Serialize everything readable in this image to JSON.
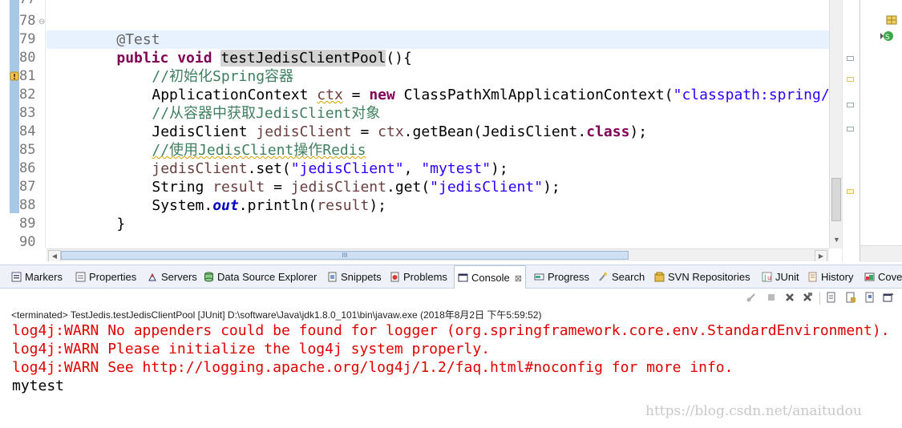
{
  "editor": {
    "line_numbers": [
      "77",
      "78",
      "79",
      "80",
      "81",
      "82",
      "83",
      "84",
      "85",
      "86",
      "87",
      "88",
      "89",
      "90"
    ],
    "annotation": "@Test",
    "method_modifiers": "public void",
    "method_name": "testJedisClientPool",
    "method_tail": "(){",
    "comment_1": "//初始化Spring容器",
    "l81_type": "ApplicationContext",
    "l81_var": "ctx",
    "l81_eq": " = ",
    "l81_new": "new",
    "l81_call": " ClassPathXmlApplicationContext(",
    "l81_str": "\"classpath:spring/app",
    "comment_2": "//从容器中获取JedisClient对象",
    "l83_type": "JedisClient ",
    "l83_var": "jedisClient",
    "l83_mid": " = ",
    "l83_ctx": "ctx",
    "l83_call": ".getBean(JedisClient.",
    "l83_class": "class",
    "l83_end": ");",
    "comment_3": "//使用JedisClient操作Redis",
    "l85_var": "jedisClient",
    "l85_call": ".set(",
    "l85_s1": "\"jedisClient\"",
    "l85_comma": ", ",
    "l85_s2": "\"mytest\"",
    "l85_end": ");",
    "l86_type": "String ",
    "l86_var": "result",
    "l86_eq": " = ",
    "l86_obj": "jedisClient",
    "l86_call": ".get(",
    "l86_s": "\"jedisClient\"",
    "l86_end": ");",
    "l87_a": "System.",
    "l87_out": "out",
    "l87_b": ".println(",
    "l87_arg": "result",
    "l87_end": ");",
    "closing_brace": "}"
  },
  "views_tabs": [
    {
      "label": "Markers",
      "icon": "markers-icon"
    },
    {
      "label": "Properties",
      "icon": "properties-icon"
    },
    {
      "label": "Servers",
      "icon": "servers-icon"
    },
    {
      "label": "Data Source Explorer",
      "icon": "data-source-icon"
    },
    {
      "label": "Snippets",
      "icon": "snippets-icon"
    },
    {
      "label": "Problems",
      "icon": "problems-icon"
    },
    {
      "label": "Console",
      "icon": "console-icon",
      "close": "⊠",
      "active": true
    },
    {
      "label": "Progress",
      "icon": "progress-icon"
    },
    {
      "label": "Search",
      "icon": "search-icon"
    },
    {
      "label": "SVN Repositories",
      "icon": "svn-icon"
    },
    {
      "label": "JUnit",
      "icon": "junit-icon"
    },
    {
      "label": "History",
      "icon": "history-icon"
    },
    {
      "label": "Cove",
      "icon": "coverage-icon"
    }
  ],
  "console": {
    "status": "<terminated> TestJedis.testJedisClientPool [JUnit] D:\\software\\Java\\jdk1.8.0_101\\bin\\javaw.exe (2018年8月2日 下午5:59:52)",
    "lines": [
      {
        "text": "log4j:WARN No appenders could be found for logger (org.springframework.core.env.StandardEnvironment).",
        "kind": "err"
      },
      {
        "text": "log4j:WARN Please initialize the log4j system properly.",
        "kind": "err"
      },
      {
        "text": "log4j:WARN See http://logging.apache.org/log4j/1.2/faq.html#noconfig for more info.",
        "kind": "err"
      },
      {
        "text": "mytest",
        "kind": "out"
      }
    ]
  },
  "watermark": "https://blog.csdn.net/anaitudou",
  "hscroll_grip": "III",
  "colors": {
    "keyword": "#7f0055",
    "comment": "#3f7f5f",
    "string": "#2a00ff",
    "error": "#e00000",
    "current_line": "#e8f2fe"
  }
}
